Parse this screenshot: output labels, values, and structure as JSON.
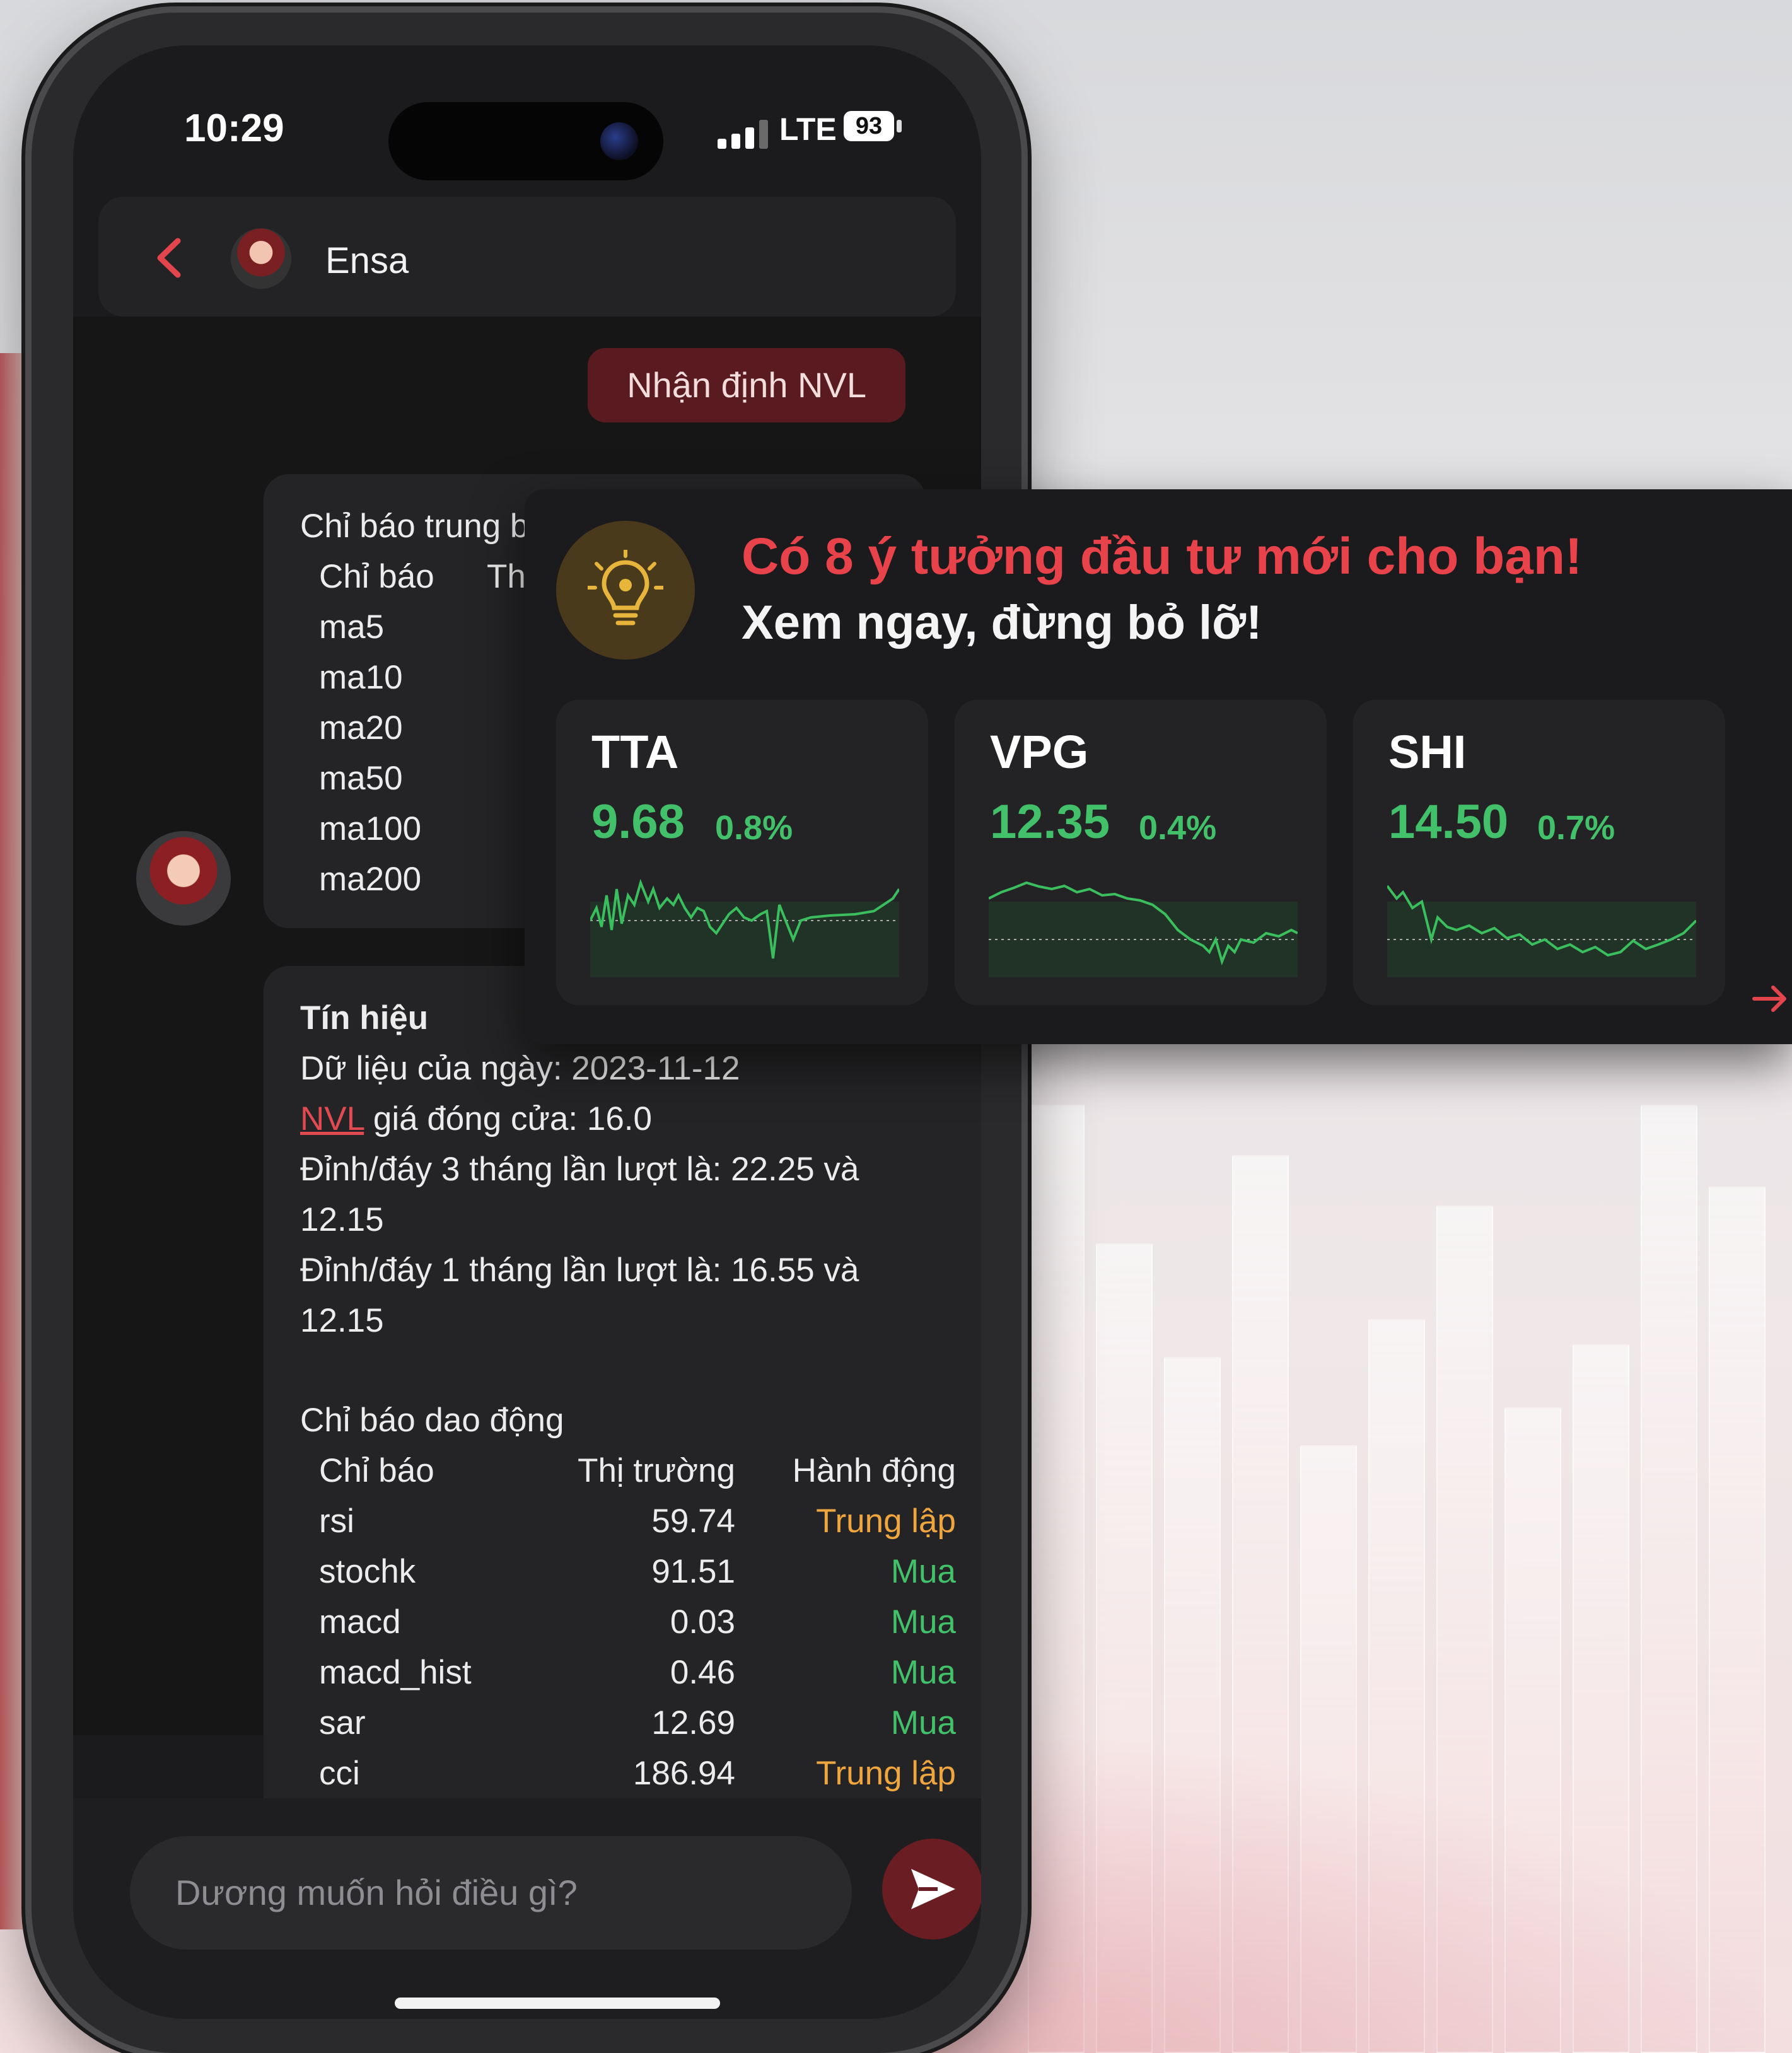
{
  "status_bar": {
    "time": "10:29",
    "network": "LTE",
    "battery": "93"
  },
  "header": {
    "name": "Ensa"
  },
  "user_message": "Nhận định NVL",
  "bubble1": {
    "title": "Chỉ báo trung bình động",
    "col_indicator": "Chỉ báo",
    "col_market": "Thị t",
    "rows": [
      "ma5",
      "ma10",
      "ma20",
      "ma50",
      "ma100",
      "ma200"
    ]
  },
  "bubble2": {
    "signal_title": "Tín hiệu",
    "data_date": "Dữ liệu của ngày: 2023-11-12",
    "ticker": "NVL",
    "close_price": " giá đóng cửa: 16.0",
    "three_month_a": "Đỉnh/đáy 3 tháng lần lượt là: 22.25 và",
    "three_month_b": "12.15",
    "one_month_a": "Đỉnh/đáy 1 tháng lần lượt là: 16.55 và",
    "one_month_b": "12.15",
    "osc_title": "Chỉ báo dao động",
    "headers": {
      "indicator": "Chỉ báo",
      "market": "Thị trường",
      "action": "Hành động"
    },
    "rows": [
      {
        "indicator": "rsi",
        "market": "59.74",
        "action": "Trung lập",
        "status": "neutral"
      },
      {
        "indicator": "stochk",
        "market": "91.51",
        "action": "Mua",
        "status": "buy"
      },
      {
        "indicator": "macd",
        "market": "0.03",
        "action": "Mua",
        "status": "buy"
      },
      {
        "indicator": "macd_hist",
        "market": "0.46",
        "action": "Mua",
        "status": "buy"
      },
      {
        "indicator": "sar",
        "market": "12.69",
        "action": "Mua",
        "status": "buy"
      },
      {
        "indicator": "cci",
        "market": "186.94",
        "action": "Trung lập",
        "status": "neutral"
      }
    ]
  },
  "input": {
    "placeholder": "Dương muốn hỏi điều gì?"
  },
  "ideas": {
    "title": "Có 8 ý tưởng đầu tư mới cho bạn!",
    "subtitle": "Xem ngay, đừng bỏ lỡ!",
    "stocks": [
      {
        "ticker": "TTA",
        "price": "9.68",
        "change": "0.8%"
      },
      {
        "ticker": "VPG",
        "price": "12.35",
        "change": "0.4%"
      },
      {
        "ticker": "SHI",
        "price": "14.50",
        "change": "0.7%"
      }
    ]
  },
  "colors": {
    "accent": "#e8434b",
    "buy": "#43c06a",
    "neutral": "#f0a63e",
    "bubble": "#242426"
  }
}
